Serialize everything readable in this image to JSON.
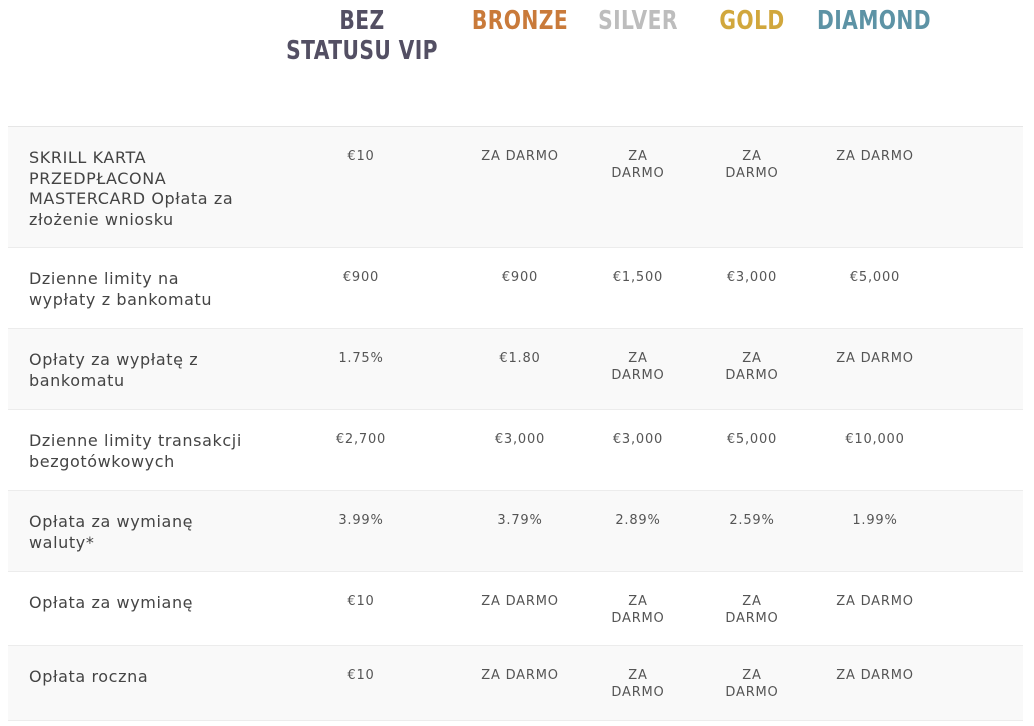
{
  "tiers": [
    {
      "label": "BEZ STATUSU VIP",
      "color": "#534f63"
    },
    {
      "label": "BRONZE",
      "color": "#c97a3a"
    },
    {
      "label": "SILVER",
      "color": "#bdbdbd"
    },
    {
      "label": "GOLD",
      "color": "#d1a73c"
    },
    {
      "label": "DIAMOND",
      "color": "#5d93a5"
    }
  ],
  "rows": [
    {
      "label": "SKRILL KARTA PRZEDPŁACONA MASTERCARD Opłata za złożenie wniosku",
      "values": [
        "€10",
        "ZA DARMO",
        "ZA DARMO",
        "ZA DARMO",
        "ZA DARMO"
      ]
    },
    {
      "label": "Dzienne limity na wypłaty z bankomatu",
      "values": [
        "€900",
        "€900",
        "€1,500",
        "€3,000",
        "€5,000"
      ]
    },
    {
      "label": "Opłaty za wypłatę z bankomatu",
      "values": [
        "1.75%",
        "€1.80",
        "ZA DARMO",
        "ZA DARMO",
        "ZA DARMO"
      ]
    },
    {
      "label": "Dzienne limity transakcji bezgotówkowych",
      "values": [
        "€2,700",
        "€3,000",
        "€3,000",
        "€5,000",
        "€10,000"
      ]
    },
    {
      "label": "Opłata za wymianę waluty*",
      "values": [
        "3.99%",
        "3.79%",
        "2.89%",
        "2.59%",
        "1.99%"
      ]
    },
    {
      "label": "Opłata za wymianę",
      "values": [
        "€10",
        "ZA DARMO",
        "ZA DARMO",
        "ZA DARMO",
        "ZA DARMO"
      ]
    },
    {
      "label": "Opłata roczna",
      "values": [
        "€10",
        "ZA DARMO",
        "ZA DARMO",
        "ZA DARMO",
        "ZA DARMO"
      ]
    }
  ]
}
